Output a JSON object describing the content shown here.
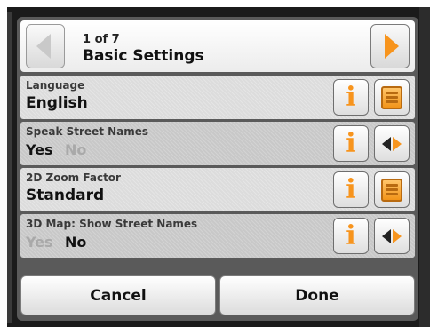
{
  "header": {
    "page_counter": "1 of 7",
    "title": "Basic Settings"
  },
  "rows": [
    {
      "label": "Language",
      "value": "English",
      "info_icon": "info-icon",
      "action_icon": "list-icon"
    },
    {
      "label": "Speak Street Names",
      "options": [
        "Yes",
        "No"
      ],
      "selected": "Yes",
      "info_icon": "info-icon",
      "action_icon": "toggle-arrows-icon"
    },
    {
      "label": "2D Zoom Factor",
      "value": "Standard",
      "info_icon": "info-icon",
      "action_icon": "list-icon"
    },
    {
      "label": "3D Map: Show Street Names",
      "options": [
        "Yes",
        "No"
      ],
      "selected": "No",
      "info_icon": "info-icon",
      "action_icon": "toggle-arrows-icon"
    }
  ],
  "footer": {
    "cancel_label": "Cancel",
    "done_label": "Done"
  },
  "colors": {
    "accent": "#f7941d",
    "disabled_text": "#a9a9a9"
  }
}
